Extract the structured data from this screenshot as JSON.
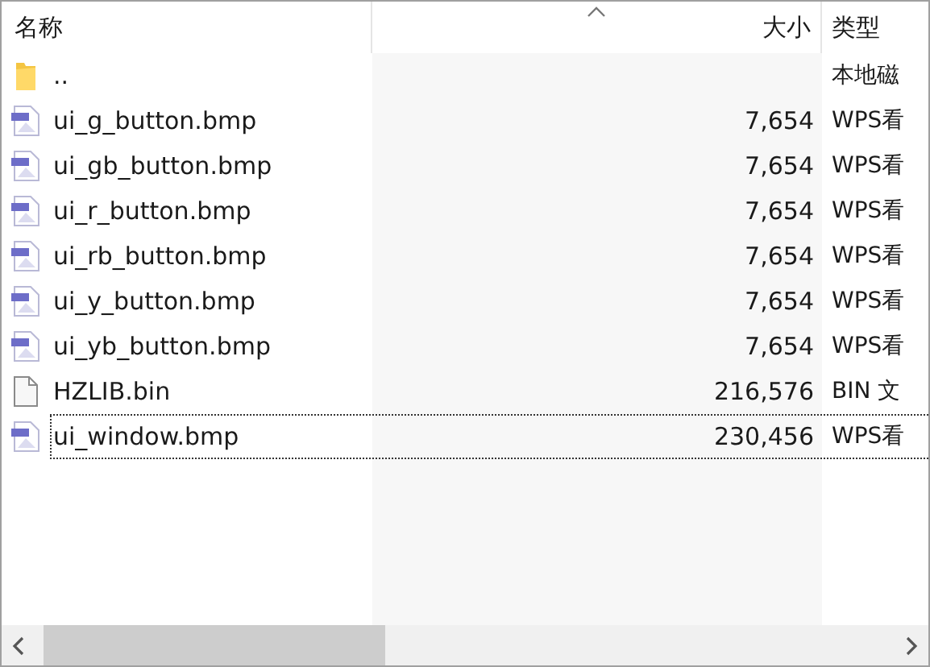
{
  "columns": [
    {
      "label": "名称",
      "sorted": false
    },
    {
      "label": "大小",
      "sorted": true
    },
    {
      "label": "类型",
      "sorted": false
    }
  ],
  "rows": [
    {
      "kind": "folder",
      "name": "..",
      "size": "",
      "type": "本地磁",
      "focused": false
    },
    {
      "kind": "image",
      "name": "ui_g_button.bmp",
      "size": "7,654",
      "type": "WPS看",
      "focused": false
    },
    {
      "kind": "image",
      "name": "ui_gb_button.bmp",
      "size": "7,654",
      "type": "WPS看",
      "focused": false
    },
    {
      "kind": "image",
      "name": "ui_r_button.bmp",
      "size": "7,654",
      "type": "WPS看",
      "focused": false
    },
    {
      "kind": "image",
      "name": "ui_rb_button.bmp",
      "size": "7,654",
      "type": "WPS看",
      "focused": false
    },
    {
      "kind": "image",
      "name": "ui_y_button.bmp",
      "size": "7,654",
      "type": "WPS看",
      "focused": false
    },
    {
      "kind": "image",
      "name": "ui_yb_button.bmp",
      "size": "7,654",
      "type": "WPS看",
      "focused": false
    },
    {
      "kind": "file",
      "name": "HZLIB.bin",
      "size": "216,576",
      "type": "BIN 文",
      "focused": false
    },
    {
      "kind": "image",
      "name": "ui_window.bmp",
      "size": "230,456",
      "type": "WPS看",
      "focused": true
    }
  ]
}
